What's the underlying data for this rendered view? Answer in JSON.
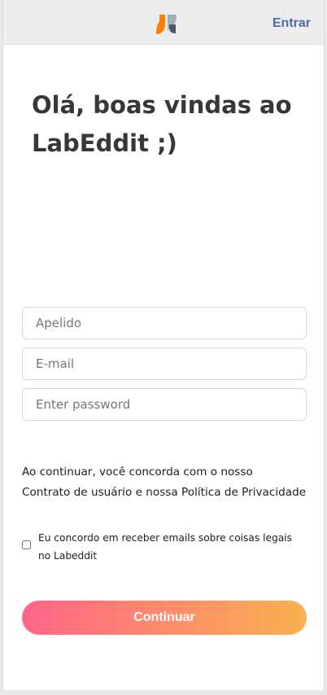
{
  "header": {
    "logo_icon": "labeddit-logo-icon",
    "login_label": "Entrar"
  },
  "main": {
    "title": "Olá, boas vindas ao LabEddit ;)"
  },
  "form": {
    "nickname_placeholder": "Apelido",
    "email_placeholder": "E-mail",
    "password_placeholder": "Enter password",
    "nickname_value": "",
    "email_value": "",
    "password_value": ""
  },
  "terms": {
    "line1": "Ao continuar, você concorda com o nosso",
    "line2": "Contrato de usuário e nossa Política de Privacidade"
  },
  "consent": {
    "checked": false,
    "label": "Eu concordo em receber emails sobre coisas legais no Labeddit"
  },
  "actions": {
    "continue_label": "Continuar"
  },
  "colors": {
    "accent_link": "#4a6fa5",
    "gradient_start": "#ff6589",
    "gradient_end": "#f9b24e",
    "logo_orange": "#fe7e02",
    "logo_slate": "#a3adb9"
  }
}
